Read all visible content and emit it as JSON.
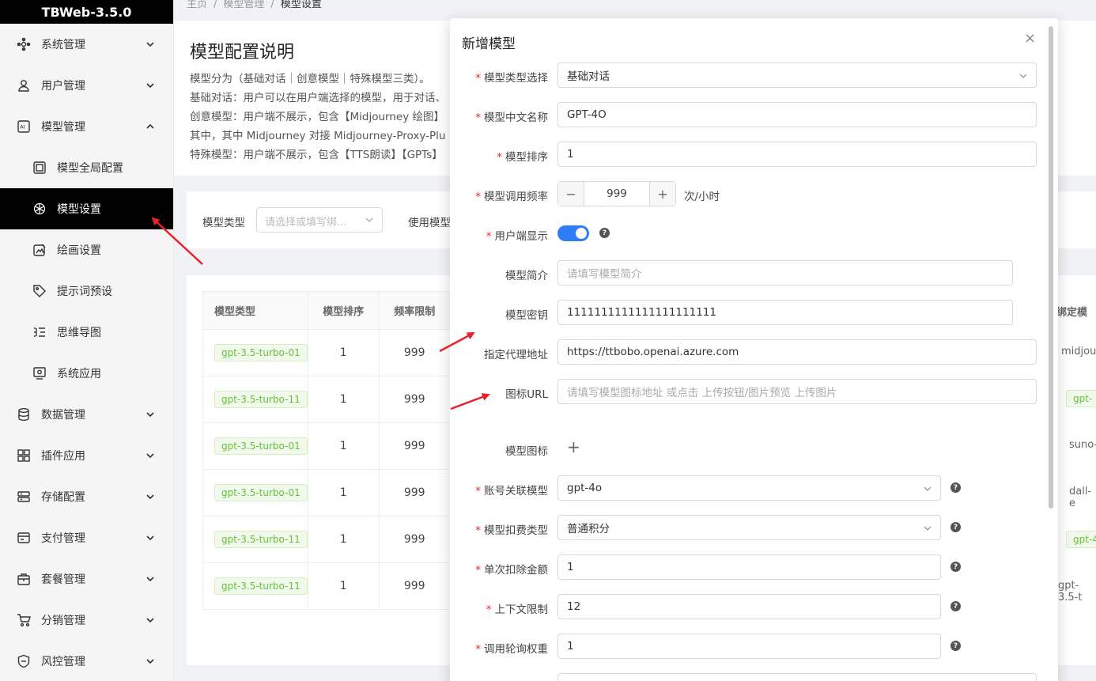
{
  "sidebar": {
    "logo": "TBWeb-3.5.0",
    "items": [
      {
        "label": "系统管理",
        "icon": "system-icon"
      },
      {
        "label": "用户管理",
        "icon": "user-icon"
      },
      {
        "label": "模型管理",
        "icon": "ai-icon",
        "expanded": true
      },
      {
        "label": "数据管理",
        "icon": "database-icon"
      },
      {
        "label": "插件应用",
        "icon": "plugin-icon"
      },
      {
        "label": "存储配置",
        "icon": "storage-icon"
      },
      {
        "label": "支付管理",
        "icon": "payment-icon"
      },
      {
        "label": "套餐管理",
        "icon": "package-icon"
      },
      {
        "label": "分销管理",
        "icon": "cart-icon"
      },
      {
        "label": "风控管理",
        "icon": "shield-icon"
      }
    ],
    "subitems": [
      {
        "label": "模型全局配置",
        "icon": "frame-icon"
      },
      {
        "label": "模型设置",
        "icon": "openai-icon",
        "active": true
      },
      {
        "label": "绘画设置",
        "icon": "image-edit-icon"
      },
      {
        "label": "提示词预设",
        "icon": "tag-icon"
      },
      {
        "label": "思维导图",
        "icon": "mindmap-icon"
      },
      {
        "label": "系统应用",
        "icon": "app-icon"
      }
    ]
  },
  "breadcrumb": [
    "主页",
    "/",
    "模型管理",
    "/",
    "模型设置"
  ],
  "info": {
    "title": "模型配置说明",
    "lines": [
      "模型分为（基础对话｜创意模型｜特殊模型三类）。",
      "基础对话：用户可以在用户端选择的模型，用于对话、",
      "创意模型：用户端不展示，包含【Midjourney 绘图】",
      "其中，其中 Midjourney 对接 Midjourney-Proxy-Plu",
      "特殊模型：用户端不展示，包含【TTS朗读】【GPTs】"
    ]
  },
  "filter": {
    "type_label": "模型类型",
    "type_placeholder": "请选择或填写绑...",
    "use_label": "使用模型"
  },
  "table": {
    "headers": [
      "模型类型",
      "模型排序",
      "频率限制"
    ],
    "right_header": "绑定模",
    "rows": [
      {
        "tag": "gpt-3.5-turbo-01",
        "order": "1",
        "limit": "999",
        "right": "midjour"
      },
      {
        "tag": "gpt-3.5-turbo-11",
        "order": "1",
        "limit": "999",
        "right": "gpt-"
      },
      {
        "tag": "gpt-3.5-turbo-01",
        "order": "1",
        "limit": "999",
        "right": "suno-"
      },
      {
        "tag": "gpt-3.5-turbo-01",
        "order": "1",
        "limit": "999",
        "right": "dall-e"
      },
      {
        "tag": "gpt-3.5-turbo-11",
        "order": "1",
        "limit": "999",
        "right": "gpt-4"
      },
      {
        "tag": "gpt-3.5-turbo-11",
        "order": "1",
        "limit": "999",
        "right": "gpt-3.5-t"
      }
    ]
  },
  "modal": {
    "title": "新增模型",
    "close": "×",
    "fields": {
      "type": {
        "label": "模型类型选择",
        "value": "基础对话"
      },
      "name": {
        "label": "模型中文名称",
        "value": "GPT-4O"
      },
      "order": {
        "label": "模型排序",
        "value": "1"
      },
      "freq": {
        "label": "模型调用频率",
        "value": "999",
        "unit": "次/小时",
        "minus": "−",
        "plus": "+"
      },
      "show": {
        "label": "用户端显示",
        "on": true
      },
      "desc": {
        "label": "模型简介",
        "placeholder": "请填写模型简介"
      },
      "key": {
        "label": "模型密钥",
        "value": "1111111111111111111111"
      },
      "proxy": {
        "label": "指定代理地址",
        "value": "https://ttbobo.openai.azure.com"
      },
      "icon_url": {
        "label": "图标URL",
        "placeholder": "请填写模型图标地址 或点击 上传按钮/图片预览 上传图片"
      },
      "icon": {
        "label": "模型图标",
        "plus": "+"
      },
      "account_model": {
        "label": "账号关联模型",
        "value": "gpt-4o"
      },
      "deduct_type": {
        "label": "模型扣费类型",
        "value": "普通积分"
      },
      "deduct_amount": {
        "label": "单次扣除金额",
        "value": "1"
      },
      "context": {
        "label": "上下文限制",
        "value": "12"
      },
      "weight": {
        "label": "调用轮询权重",
        "value": "1"
      }
    }
  },
  "colors": {
    "primary": "#2f7df6",
    "required": "#f5222d",
    "arrow": "#e8222a",
    "tag_green": "#67c23a"
  }
}
